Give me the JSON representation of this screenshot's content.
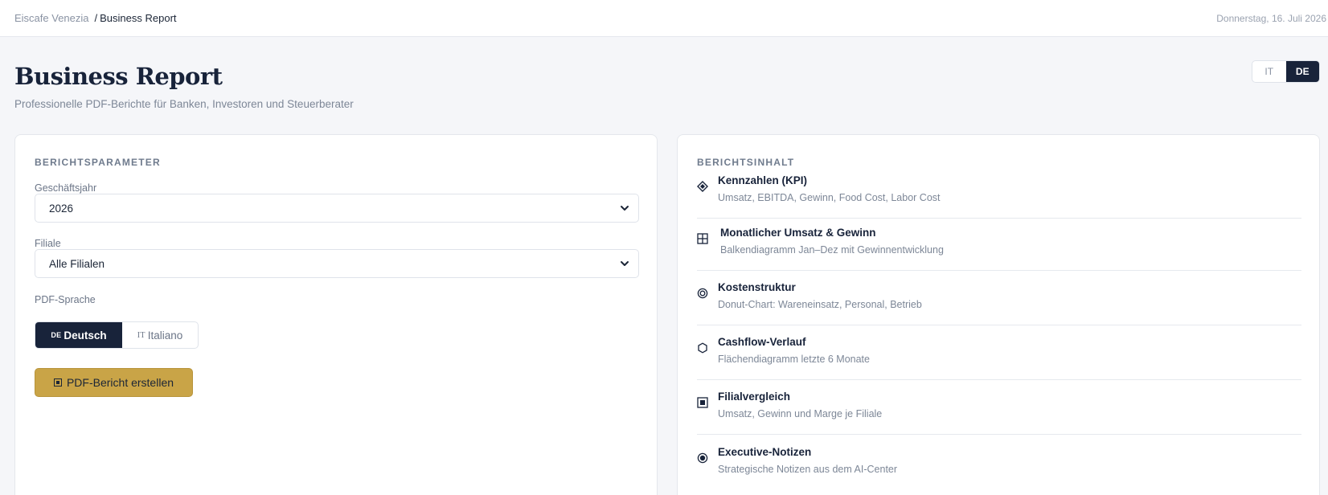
{
  "header": {
    "breadcrumb_root": "Eiscafe Venezia",
    "breadcrumb_separator": "/",
    "breadcrumb_current": "Business Report",
    "date": "Donnerstag, 16. Juli 2026"
  },
  "page": {
    "title": "Business Report",
    "subtitle": "Professionelle PDF-Berichte für Banken, Investoren und Steuerberater"
  },
  "ui_language": {
    "options": [
      "IT",
      "DE"
    ],
    "selected": "DE"
  },
  "parameters": {
    "heading": "BERICHTSPARAMETER",
    "fiscal_year": {
      "label": "Geschäftsjahr",
      "value": "2026"
    },
    "branch": {
      "label": "Filiale",
      "value": "Alle Filialen"
    },
    "pdf_language": {
      "label": "PDF-Sprache",
      "de_flag": "DE",
      "de_label": "Deutsch",
      "it_flag": "IT",
      "it_label": "Italiano",
      "selected": "Deutsch"
    },
    "generate_button": "PDF-Bericht erstellen"
  },
  "contents": {
    "heading": "BERICHTSINHALT",
    "items": [
      {
        "title": "Kennzahlen (KPI)",
        "description": "Umsatz, EBITDA, Gewinn, Food Cost, Labor Cost",
        "icon": "diamond-icon"
      },
      {
        "title": "Monatlicher Umsatz & Gewinn",
        "description": "Balkendiagramm Jan–Dez mit Gewinnentwicklung",
        "icon": "grid-icon"
      },
      {
        "title": "Kostenstruktur",
        "description": "Donut-Chart: Wareneinsatz, Personal, Betrieb",
        "icon": "donut-icon"
      },
      {
        "title": "Cashflow-Verlauf",
        "description": "Flächendiagramm letzte 6 Monate",
        "icon": "hexagon-icon"
      },
      {
        "title": "Filialvergleich",
        "description": "Umsatz, Gewinn und Marge je Filiale",
        "icon": "square-icon"
      },
      {
        "title": "Executive-Notizen",
        "description": "Strategische Notizen aus dem AI-Center",
        "icon": "radio-icon"
      }
    ]
  },
  "colors": {
    "primary_dark": "#18233a",
    "accent_gold": "#c9a447",
    "background": "#f5f6f9"
  }
}
